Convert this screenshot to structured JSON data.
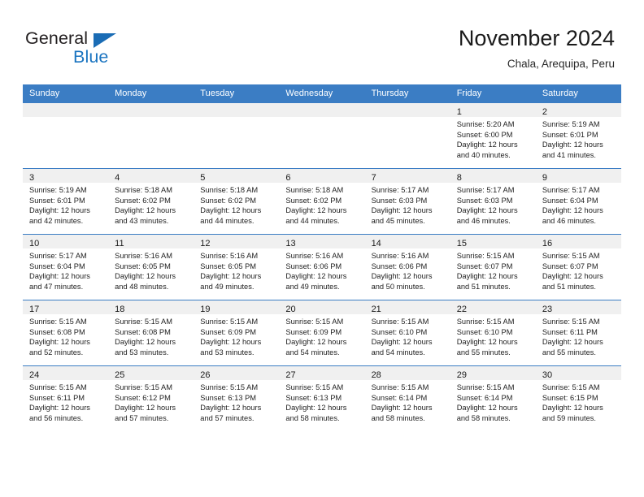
{
  "brand": {
    "name_top": "General",
    "name_bottom": "Blue",
    "triangle_color": "#1a6cb5",
    "text_color": "#231f20",
    "blue_text_color": "#1a74c0"
  },
  "header": {
    "title": "November 2024",
    "subtitle": "Chala, Arequipa, Peru"
  },
  "theme": {
    "header_row_bg": "#3b7dc4",
    "header_row_text": "#ffffff",
    "daynum_band_bg": "#f0f0f0",
    "cell_border": "#3b7dc4",
    "cell_bg": "#ffffff"
  },
  "weekday_headers": [
    "Sunday",
    "Monday",
    "Tuesday",
    "Wednesday",
    "Thursday",
    "Friday",
    "Saturday"
  ],
  "weeks": [
    [
      {
        "day": "",
        "empty": true,
        "sunrise": "",
        "sunset": "",
        "daylight_line1": "",
        "daylight_line2": ""
      },
      {
        "day": "",
        "empty": true,
        "sunrise": "",
        "sunset": "",
        "daylight_line1": "",
        "daylight_line2": ""
      },
      {
        "day": "",
        "empty": true,
        "sunrise": "",
        "sunset": "",
        "daylight_line1": "",
        "daylight_line2": ""
      },
      {
        "day": "",
        "empty": true,
        "sunrise": "",
        "sunset": "",
        "daylight_line1": "",
        "daylight_line2": ""
      },
      {
        "day": "",
        "empty": true,
        "sunrise": "",
        "sunset": "",
        "daylight_line1": "",
        "daylight_line2": ""
      },
      {
        "day": "1",
        "empty": false,
        "sunrise": "Sunrise: 5:20 AM",
        "sunset": "Sunset: 6:00 PM",
        "daylight_line1": "Daylight: 12 hours",
        "daylight_line2": "and 40 minutes."
      },
      {
        "day": "2",
        "empty": false,
        "sunrise": "Sunrise: 5:19 AM",
        "sunset": "Sunset: 6:01 PM",
        "daylight_line1": "Daylight: 12 hours",
        "daylight_line2": "and 41 minutes."
      }
    ],
    [
      {
        "day": "3",
        "empty": false,
        "sunrise": "Sunrise: 5:19 AM",
        "sunset": "Sunset: 6:01 PM",
        "daylight_line1": "Daylight: 12 hours",
        "daylight_line2": "and 42 minutes."
      },
      {
        "day": "4",
        "empty": false,
        "sunrise": "Sunrise: 5:18 AM",
        "sunset": "Sunset: 6:02 PM",
        "daylight_line1": "Daylight: 12 hours",
        "daylight_line2": "and 43 minutes."
      },
      {
        "day": "5",
        "empty": false,
        "sunrise": "Sunrise: 5:18 AM",
        "sunset": "Sunset: 6:02 PM",
        "daylight_line1": "Daylight: 12 hours",
        "daylight_line2": "and 44 minutes."
      },
      {
        "day": "6",
        "empty": false,
        "sunrise": "Sunrise: 5:18 AM",
        "sunset": "Sunset: 6:02 PM",
        "daylight_line1": "Daylight: 12 hours",
        "daylight_line2": "and 44 minutes."
      },
      {
        "day": "7",
        "empty": false,
        "sunrise": "Sunrise: 5:17 AM",
        "sunset": "Sunset: 6:03 PM",
        "daylight_line1": "Daylight: 12 hours",
        "daylight_line2": "and 45 minutes."
      },
      {
        "day": "8",
        "empty": false,
        "sunrise": "Sunrise: 5:17 AM",
        "sunset": "Sunset: 6:03 PM",
        "daylight_line1": "Daylight: 12 hours",
        "daylight_line2": "and 46 minutes."
      },
      {
        "day": "9",
        "empty": false,
        "sunrise": "Sunrise: 5:17 AM",
        "sunset": "Sunset: 6:04 PM",
        "daylight_line1": "Daylight: 12 hours",
        "daylight_line2": "and 46 minutes."
      }
    ],
    [
      {
        "day": "10",
        "empty": false,
        "sunrise": "Sunrise: 5:17 AM",
        "sunset": "Sunset: 6:04 PM",
        "daylight_line1": "Daylight: 12 hours",
        "daylight_line2": "and 47 minutes."
      },
      {
        "day": "11",
        "empty": false,
        "sunrise": "Sunrise: 5:16 AM",
        "sunset": "Sunset: 6:05 PM",
        "daylight_line1": "Daylight: 12 hours",
        "daylight_line2": "and 48 minutes."
      },
      {
        "day": "12",
        "empty": false,
        "sunrise": "Sunrise: 5:16 AM",
        "sunset": "Sunset: 6:05 PM",
        "daylight_line1": "Daylight: 12 hours",
        "daylight_line2": "and 49 minutes."
      },
      {
        "day": "13",
        "empty": false,
        "sunrise": "Sunrise: 5:16 AM",
        "sunset": "Sunset: 6:06 PM",
        "daylight_line1": "Daylight: 12 hours",
        "daylight_line2": "and 49 minutes."
      },
      {
        "day": "14",
        "empty": false,
        "sunrise": "Sunrise: 5:16 AM",
        "sunset": "Sunset: 6:06 PM",
        "daylight_line1": "Daylight: 12 hours",
        "daylight_line2": "and 50 minutes."
      },
      {
        "day": "15",
        "empty": false,
        "sunrise": "Sunrise: 5:15 AM",
        "sunset": "Sunset: 6:07 PM",
        "daylight_line1": "Daylight: 12 hours",
        "daylight_line2": "and 51 minutes."
      },
      {
        "day": "16",
        "empty": false,
        "sunrise": "Sunrise: 5:15 AM",
        "sunset": "Sunset: 6:07 PM",
        "daylight_line1": "Daylight: 12 hours",
        "daylight_line2": "and 51 minutes."
      }
    ],
    [
      {
        "day": "17",
        "empty": false,
        "sunrise": "Sunrise: 5:15 AM",
        "sunset": "Sunset: 6:08 PM",
        "daylight_line1": "Daylight: 12 hours",
        "daylight_line2": "and 52 minutes."
      },
      {
        "day": "18",
        "empty": false,
        "sunrise": "Sunrise: 5:15 AM",
        "sunset": "Sunset: 6:08 PM",
        "daylight_line1": "Daylight: 12 hours",
        "daylight_line2": "and 53 minutes."
      },
      {
        "day": "19",
        "empty": false,
        "sunrise": "Sunrise: 5:15 AM",
        "sunset": "Sunset: 6:09 PM",
        "daylight_line1": "Daylight: 12 hours",
        "daylight_line2": "and 53 minutes."
      },
      {
        "day": "20",
        "empty": false,
        "sunrise": "Sunrise: 5:15 AM",
        "sunset": "Sunset: 6:09 PM",
        "daylight_line1": "Daylight: 12 hours",
        "daylight_line2": "and 54 minutes."
      },
      {
        "day": "21",
        "empty": false,
        "sunrise": "Sunrise: 5:15 AM",
        "sunset": "Sunset: 6:10 PM",
        "daylight_line1": "Daylight: 12 hours",
        "daylight_line2": "and 54 minutes."
      },
      {
        "day": "22",
        "empty": false,
        "sunrise": "Sunrise: 5:15 AM",
        "sunset": "Sunset: 6:10 PM",
        "daylight_line1": "Daylight: 12 hours",
        "daylight_line2": "and 55 minutes."
      },
      {
        "day": "23",
        "empty": false,
        "sunrise": "Sunrise: 5:15 AM",
        "sunset": "Sunset: 6:11 PM",
        "daylight_line1": "Daylight: 12 hours",
        "daylight_line2": "and 55 minutes."
      }
    ],
    [
      {
        "day": "24",
        "empty": false,
        "sunrise": "Sunrise: 5:15 AM",
        "sunset": "Sunset: 6:11 PM",
        "daylight_line1": "Daylight: 12 hours",
        "daylight_line2": "and 56 minutes."
      },
      {
        "day": "25",
        "empty": false,
        "sunrise": "Sunrise: 5:15 AM",
        "sunset": "Sunset: 6:12 PM",
        "daylight_line1": "Daylight: 12 hours",
        "daylight_line2": "and 57 minutes."
      },
      {
        "day": "26",
        "empty": false,
        "sunrise": "Sunrise: 5:15 AM",
        "sunset": "Sunset: 6:13 PM",
        "daylight_line1": "Daylight: 12 hours",
        "daylight_line2": "and 57 minutes."
      },
      {
        "day": "27",
        "empty": false,
        "sunrise": "Sunrise: 5:15 AM",
        "sunset": "Sunset: 6:13 PM",
        "daylight_line1": "Daylight: 12 hours",
        "daylight_line2": "and 58 minutes."
      },
      {
        "day": "28",
        "empty": false,
        "sunrise": "Sunrise: 5:15 AM",
        "sunset": "Sunset: 6:14 PM",
        "daylight_line1": "Daylight: 12 hours",
        "daylight_line2": "and 58 minutes."
      },
      {
        "day": "29",
        "empty": false,
        "sunrise": "Sunrise: 5:15 AM",
        "sunset": "Sunset: 6:14 PM",
        "daylight_line1": "Daylight: 12 hours",
        "daylight_line2": "and 58 minutes."
      },
      {
        "day": "30",
        "empty": false,
        "sunrise": "Sunrise: 5:15 AM",
        "sunset": "Sunset: 6:15 PM",
        "daylight_line1": "Daylight: 12 hours",
        "daylight_line2": "and 59 minutes."
      }
    ]
  ]
}
